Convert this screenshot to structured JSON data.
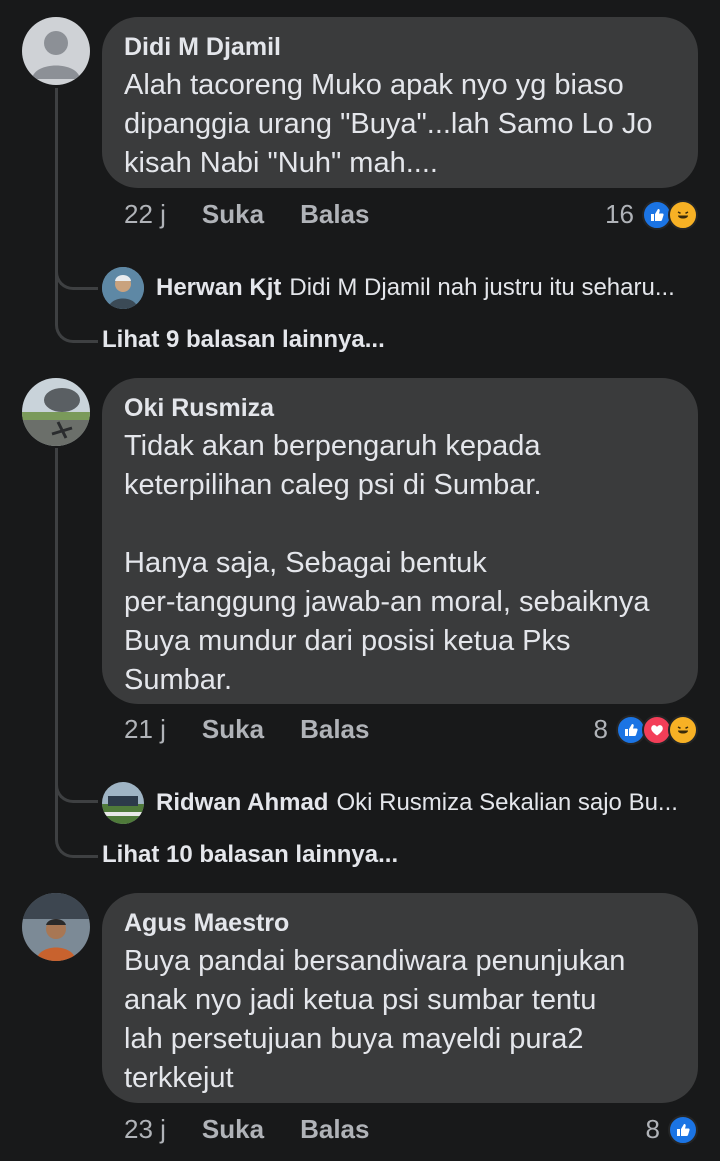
{
  "comments": [
    {
      "author": "Didi M Djamil",
      "text": "Alah tacoreng Muko apak nyo yg biaso\ndipanggia urang \"Buya\"...lah Samo Lo Jo\nkisah Nabi \"Nuh\" mah....",
      "time": "22 j",
      "like_label": "Suka",
      "reply_label": "Balas",
      "reaction_count": "16",
      "reactions": [
        "like-icon",
        "haha-icon"
      ],
      "reply_preview": {
        "author": "Herwan Kjt",
        "text": "Didi M Djamil nah justru itu seharu..."
      },
      "more_replies": "Lihat 9 balasan lainnya..."
    },
    {
      "author": "Oki Rusmiza",
      "text": "Tidak akan berpengaruh kepada\nketerpilihan caleg psi di Sumbar.\n\nHanya saja, Sebagai bentuk\nper-tanggung jawab-an moral, sebaiknya\nBuya mundur dari posisi ketua Pks\nSumbar.",
      "time": "21 j",
      "like_label": "Suka",
      "reply_label": "Balas",
      "reaction_count": "8",
      "reactions": [
        "like-icon",
        "love-icon",
        "haha-icon"
      ],
      "reply_preview": {
        "author": "Ridwan Ahmad",
        "text": "Oki Rusmiza Sekalian sajo Bu..."
      },
      "more_replies": "Lihat 10 balasan lainnya..."
    },
    {
      "author": "Agus Maestro",
      "text": "Buya  pandai bersandiwara   penunjukan\nanak nyo jadi   ketua psi sumbar   tentu\nlah persetujuan buya   mayeldi    pura2\nterkkejut",
      "time": "23 j",
      "like_label": "Suka",
      "reply_label": "Balas",
      "reaction_count": "8",
      "reactions": [
        "like-icon"
      ]
    }
  ],
  "colors": {
    "background": "#18191a",
    "bubble": "#3a3b3c",
    "text": "#e4e6eb",
    "meta": "#b0b3b8",
    "like": "#1b74e4",
    "love": "#f33e58",
    "haha": "#f7b125"
  }
}
